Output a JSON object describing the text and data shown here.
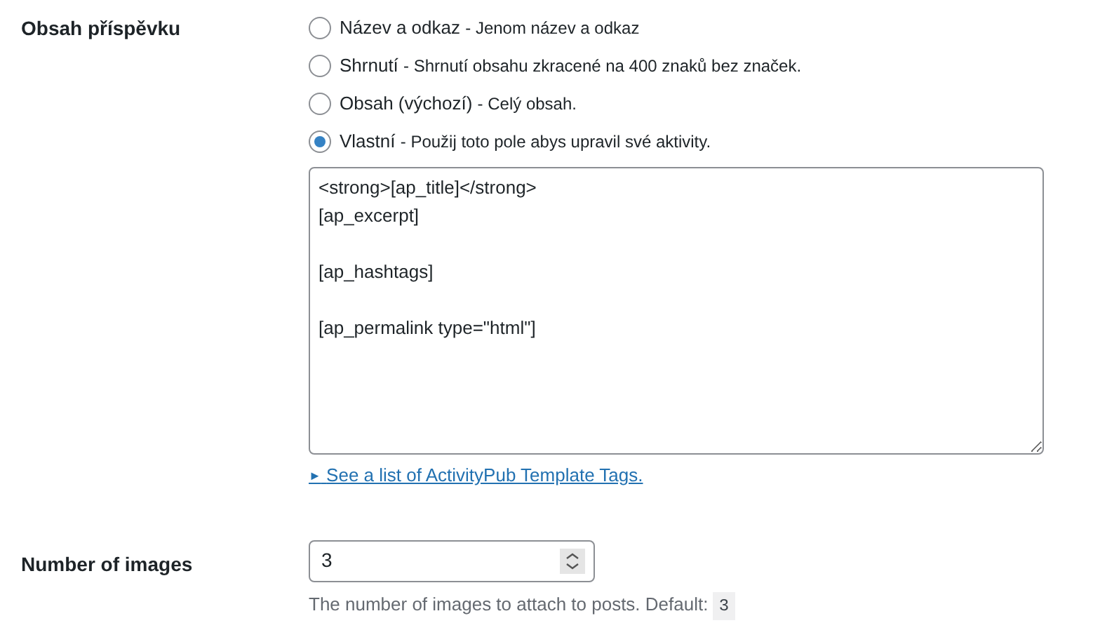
{
  "post_content": {
    "label": "Obsah příspěvku",
    "options": [
      {
        "title": "Název a odkaz",
        "description": "- Jenom název a odkaz",
        "selected": false
      },
      {
        "title": "Shrnutí",
        "description": "- Shrnutí obsahu zkracené na 400 znaků bez značek.",
        "selected": false
      },
      {
        "title": "Obsah (výchozí)",
        "description": "- Celý obsah.",
        "selected": false
      },
      {
        "title": "Vlastní",
        "description": "- Použij toto pole abys upravil své aktivity.",
        "selected": true
      }
    ],
    "template": "<strong>[ap_title]</strong>\n[ap_excerpt]\n\n[ap_hashtags]\n\n[ap_permalink type=\"html\"]",
    "link": "See a list of ActivityPub Template Tags.",
    "link_marker": "►"
  },
  "number_of_images": {
    "label": "Number of images",
    "value": "3",
    "description": "The number of images to attach to posts. Default:",
    "default": "3"
  }
}
